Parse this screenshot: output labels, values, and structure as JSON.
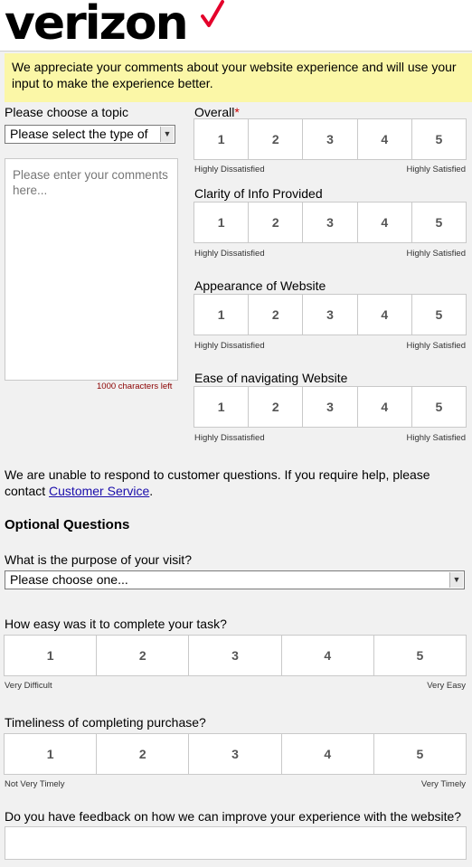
{
  "brand": {
    "name": "verizon",
    "check_color": "#e4002b"
  },
  "notice": {
    "text": "We appreciate your comments about your website experience and will use your input to make the experience better."
  },
  "topic": {
    "label": "Please choose a topic",
    "select_value": "Please select the type of"
  },
  "comments": {
    "placeholder": "Please enter your comments here...",
    "chars_left": "1000 characters left"
  },
  "ratings": [
    {
      "label": "Overall",
      "required": true,
      "low": "Highly Dissatisfied",
      "high": "Highly Satisfied"
    },
    {
      "label": "Clarity of Info Provided",
      "low": "Highly Dissatisfied",
      "high": "Highly Satisfied"
    },
    {
      "label": "Appearance of Website",
      "low": "Highly Dissatisfied",
      "high": "Highly Satisfied"
    },
    {
      "label": "Ease of navigating Website",
      "low": "Highly Dissatisfied",
      "high": "Highly Satisfied"
    }
  ],
  "scale_values": [
    "1",
    "2",
    "3",
    "4",
    "5"
  ],
  "customer_service": {
    "text": "We are unable to respond to customer questions. If you require help, please contact ",
    "link": "Customer Service",
    "end": "."
  },
  "optional": {
    "heading": "Optional Questions",
    "purpose_label": "What is the purpose of your visit?",
    "purpose_value": "Please choose one...",
    "ease_label": "How easy was it to complete your task?",
    "ease_low": "Very Difficult",
    "ease_high": "Very Easy",
    "timely_label": "Timeliness of completing purchase?",
    "timely_low": "Not Very Timely",
    "timely_high": "Very Timely",
    "feedback_label": "Do you have feedback on how we can improve your experience with the website?"
  }
}
